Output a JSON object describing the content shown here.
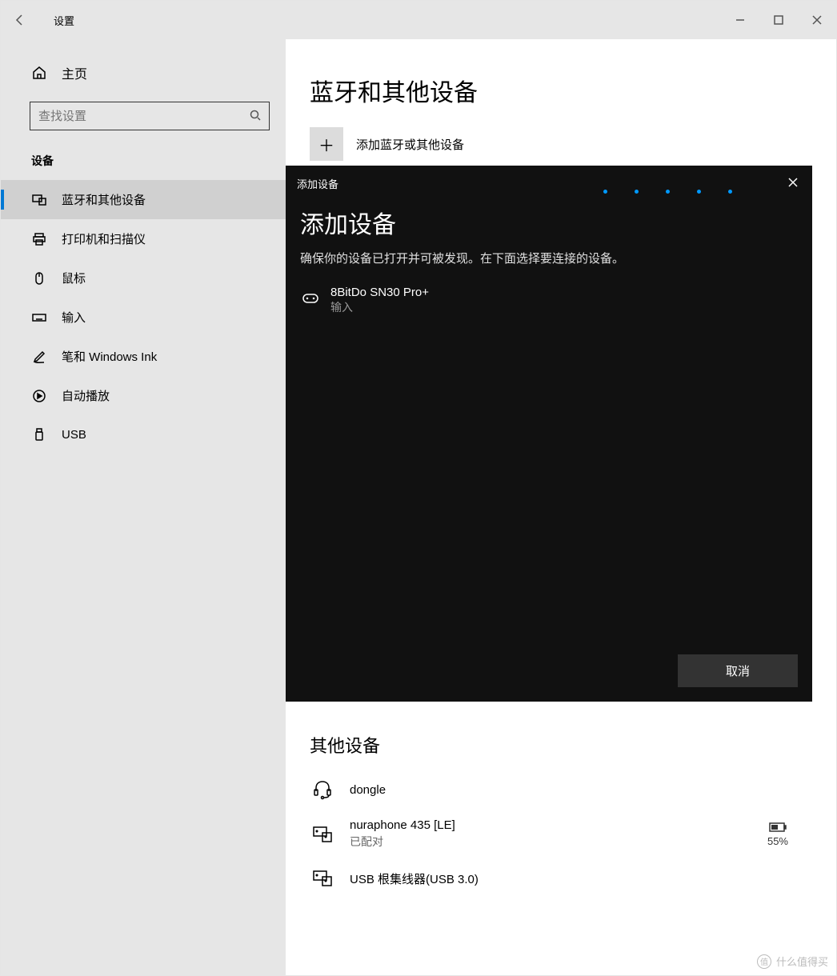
{
  "titlebar": {
    "title": "设置"
  },
  "sidebar": {
    "home_label": "主页",
    "search_placeholder": "查找设置",
    "section_title": "设备",
    "items": [
      {
        "label": "蓝牙和其他设备"
      },
      {
        "label": "打印机和扫描仪"
      },
      {
        "label": "鼠标"
      },
      {
        "label": "输入"
      },
      {
        "label": "笔和 Windows Ink"
      },
      {
        "label": "自动播放"
      },
      {
        "label": "USB"
      }
    ]
  },
  "main": {
    "heading": "蓝牙和其他设备",
    "add_label": "添加蓝牙或其他设备",
    "other_heading": "其他设备",
    "devices": [
      {
        "name": "dongle",
        "status": ""
      },
      {
        "name": "nuraphone 435 [LE]",
        "status": "已配对",
        "battery": "55%"
      },
      {
        "name": "USB 根集线器(USB 3.0)",
        "status": ""
      }
    ]
  },
  "dialog": {
    "header_title": "添加设备",
    "heading": "添加设备",
    "description": "确保你的设备已打开并可被发现。在下面选择要连接的设备。",
    "found": {
      "name": "8BitDo SN30 Pro+",
      "type": "输入"
    },
    "cancel_label": "取消"
  },
  "watermark": "什么值得买"
}
